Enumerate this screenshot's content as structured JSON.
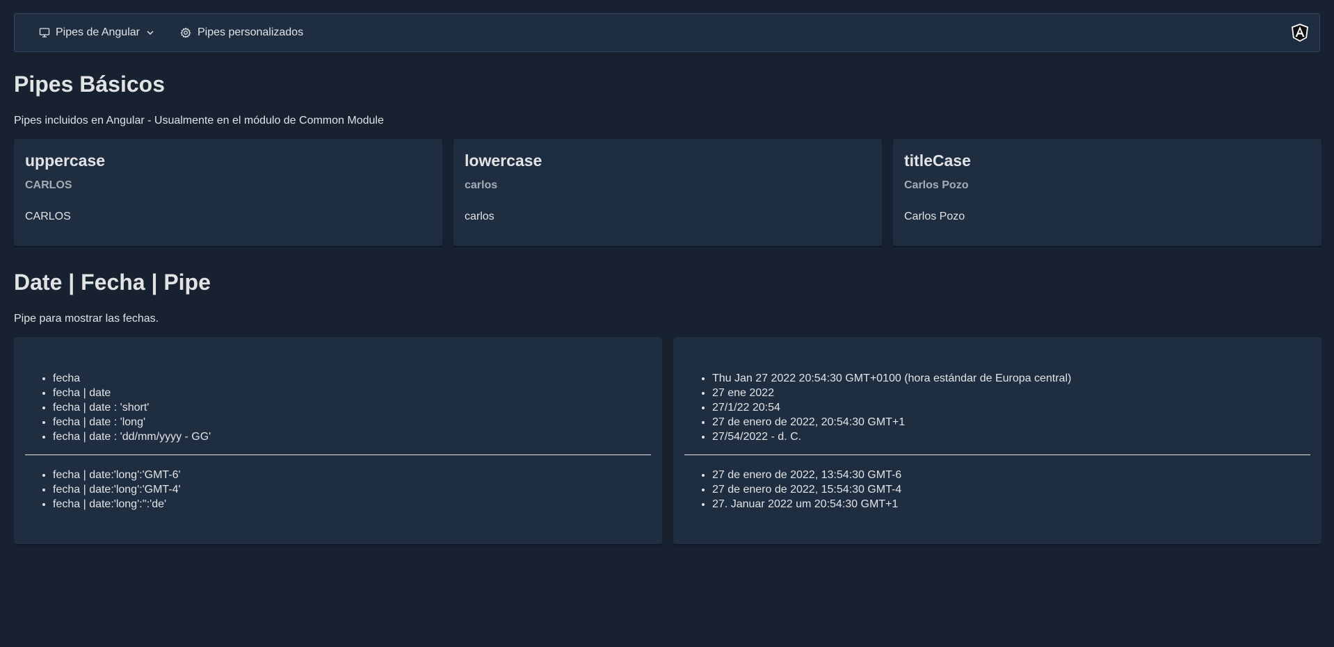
{
  "menubar": {
    "items": [
      {
        "label": "Pipes de Angular",
        "icon": "desktop-icon",
        "has_dropdown": true
      },
      {
        "label": "Pipes personalizados",
        "icon": "gear-icon",
        "has_dropdown": false
      }
    ],
    "logo": "angular-logo-icon"
  },
  "basic_section": {
    "title": "Pipes Básicos",
    "subtitle": "Pipes incluidos en Angular - Usualmente en el módulo de Common Module",
    "cards": [
      {
        "title": "uppercase",
        "subtitle": "CARLOS",
        "content": "CARLOS"
      },
      {
        "title": "lowercase",
        "subtitle": "carlos",
        "content": "carlos"
      },
      {
        "title": "titleCase",
        "subtitle": "Carlos Pozo",
        "content": "Carlos Pozo"
      }
    ]
  },
  "date_section": {
    "title": "Date | Fecha | Pipe",
    "subtitle": "Pipe para mostrar las fechas.",
    "left_top": [
      "fecha",
      "fecha | date",
      "fecha | date : 'short'",
      "fecha | date : 'long'",
      "fecha | date : 'dd/mm/yyyy - GG'"
    ],
    "left_bottom": [
      "fecha | date:'long':'GMT-6'",
      "fecha | date:'long':'GMT-4'",
      "fecha | date:'long':'':'de'"
    ],
    "right_top": [
      "Thu Jan 27 2022 20:54:30 GMT+0100 (hora estándar de Europa central)",
      "27 ene 2022",
      "27/1/22 20:54",
      "27 de enero de 2022, 20:54:30 GMT+1",
      "27/54/2022 - d. C."
    ],
    "right_bottom": [
      "27 de enero de 2022, 13:54:30 GMT-6",
      "27 de enero de 2022, 15:54:30 GMT-4",
      "27. Januar 2022 um 20:54:30 GMT+1"
    ]
  },
  "colors": {
    "background": "#172130",
    "surface": "#1f2d40",
    "border": "#304562",
    "text": "#ffffff"
  }
}
